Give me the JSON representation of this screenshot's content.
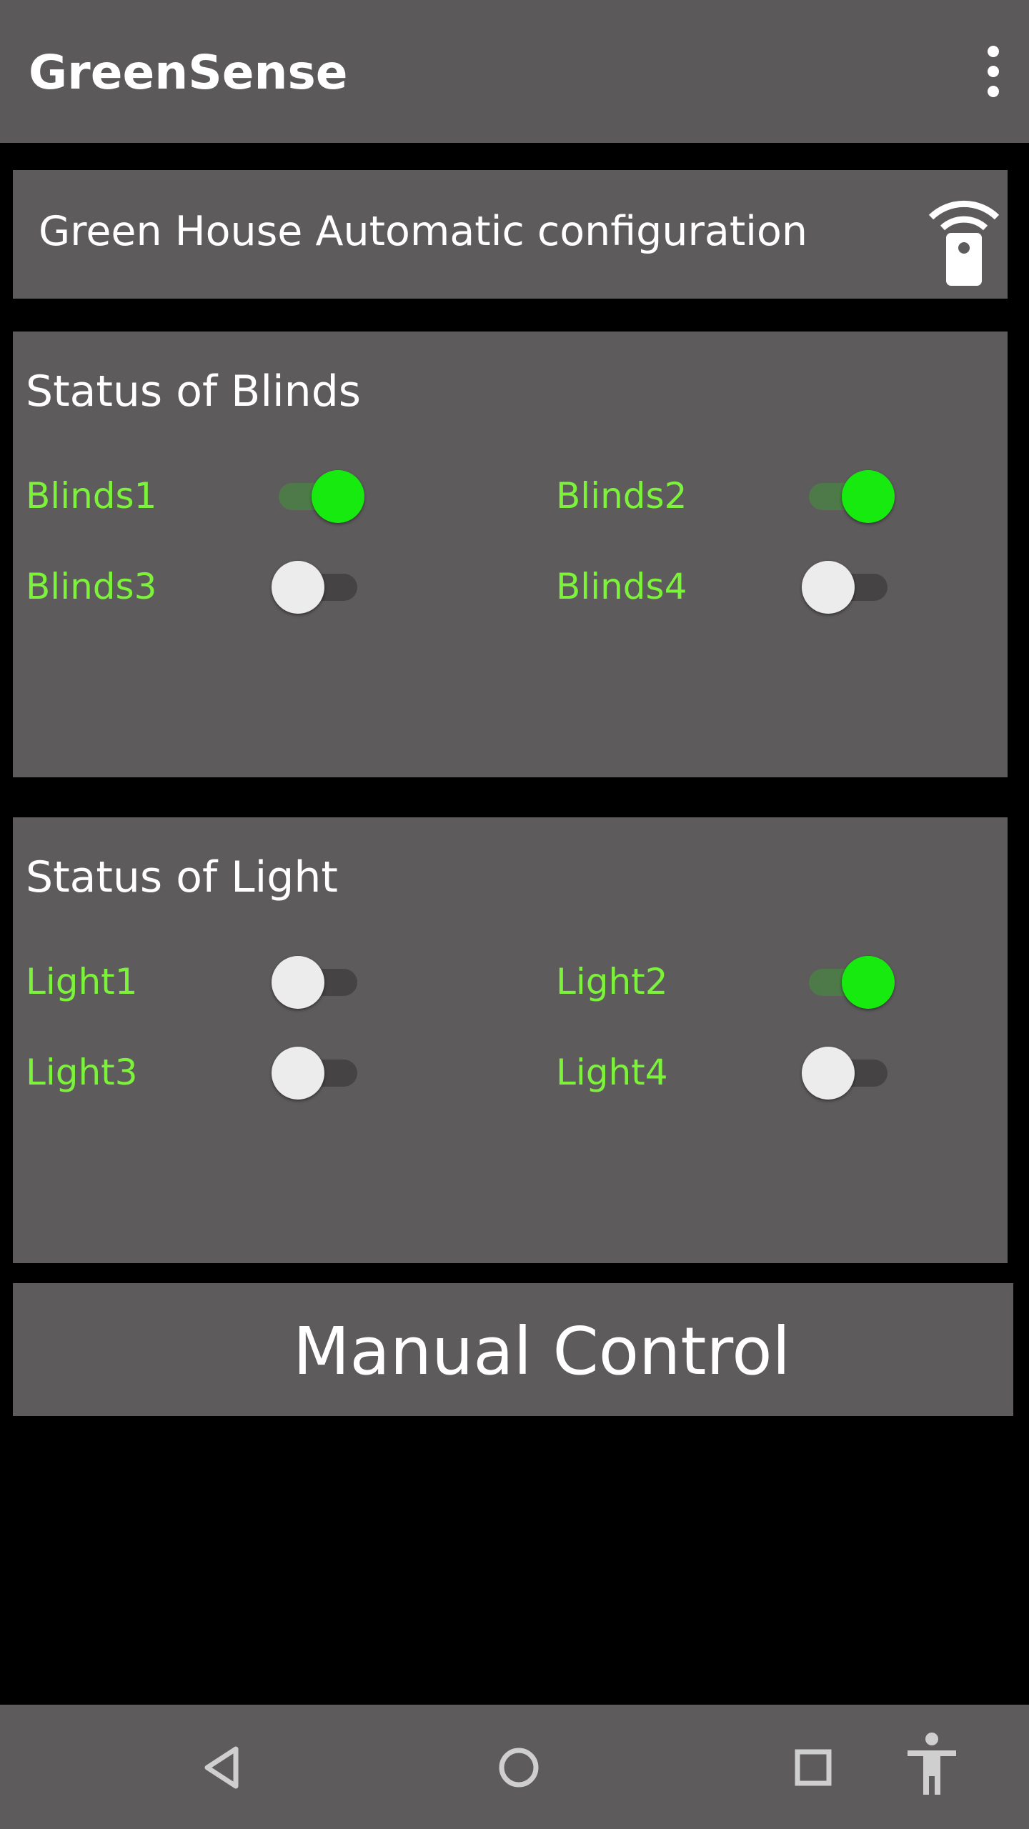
{
  "app": {
    "title": "GreenSense",
    "menu_icon": "more-vert-icon"
  },
  "config": {
    "title": "Green House Automatic configuration",
    "icon": "remote-control-icon"
  },
  "blinds": {
    "title": "Status of Blinds",
    "items": [
      {
        "label": "Blinds1",
        "on": true
      },
      {
        "label": "Blinds2",
        "on": true
      },
      {
        "label": "Blinds3",
        "on": false
      },
      {
        "label": "Blinds4",
        "on": false
      }
    ]
  },
  "light": {
    "title": "Status of Light",
    "items": [
      {
        "label": "Light1",
        "on": false
      },
      {
        "label": "Light2",
        "on": true
      },
      {
        "label": "Light3",
        "on": false
      },
      {
        "label": "Light4",
        "on": false
      }
    ]
  },
  "manual": {
    "label": "Manual Control"
  },
  "navbar": {
    "buttons": [
      "back-icon",
      "home-icon",
      "recents-icon",
      "accessibility-icon"
    ]
  },
  "colors": {
    "label_green": "#7cf23a",
    "toggle_on": "#17ea0e",
    "card_bg": "#5e5b5d",
    "appbar_bg": "#5b5959"
  }
}
